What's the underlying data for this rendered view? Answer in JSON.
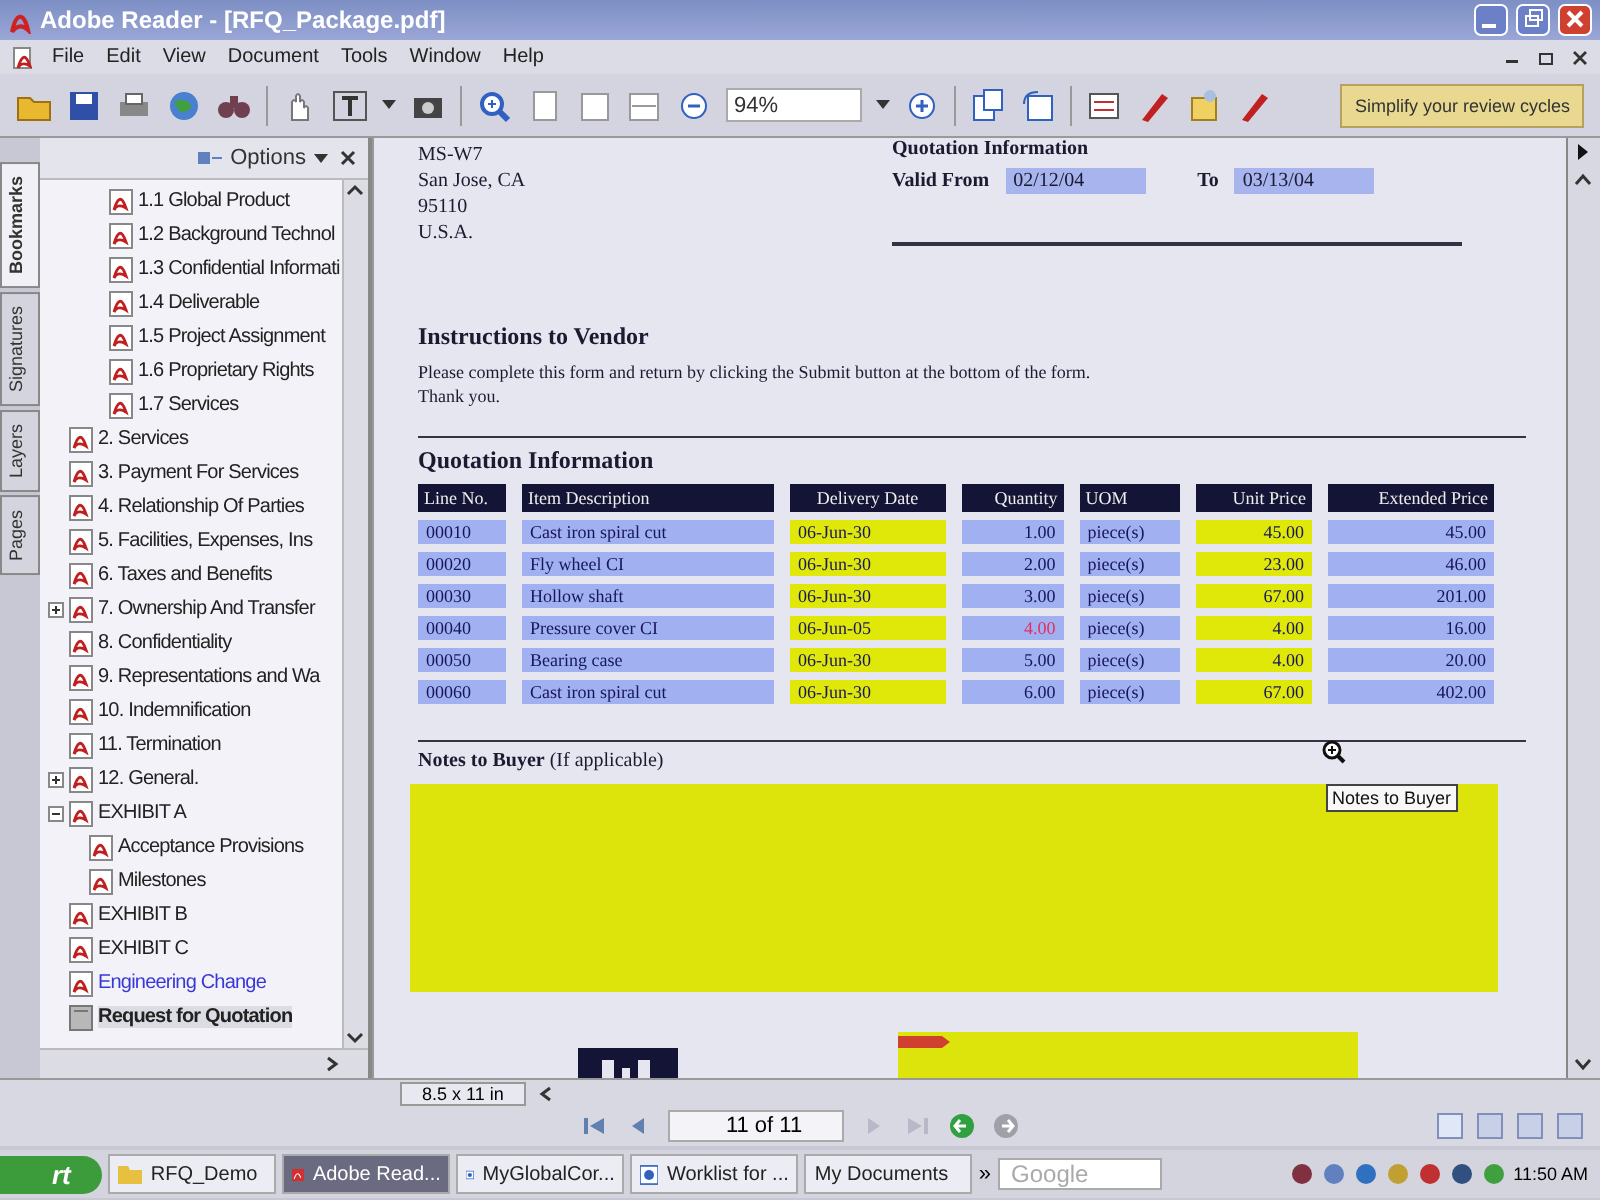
{
  "window": {
    "title": "Adobe Reader - [RFQ_Package.pdf]"
  },
  "menu": [
    "File",
    "Edit",
    "View",
    "Document",
    "Tools",
    "Window",
    "Help"
  ],
  "toolbar": {
    "zoom": "94%",
    "promo": "Simplify your review cycles"
  },
  "sidebar": {
    "tabs": [
      {
        "label": "Bookmarks",
        "selected": true
      },
      {
        "label": "Signatures",
        "selected": false
      },
      {
        "label": "Layers",
        "selected": false
      },
      {
        "label": "Pages",
        "selected": false
      }
    ],
    "options": "Options",
    "bookmarks": [
      {
        "children": [
          {
            "label": "1.1 Global Product",
            "kind": "pdf",
            "selected": false
          },
          {
            "label": "1.2 Background Technol",
            "kind": "pdf",
            "selected": false
          },
          {
            "label": "1.3 Confidential Informati",
            "kind": "pdf",
            "selected": false
          },
          {
            "label": "1.4 Deliverable",
            "kind": "pdf",
            "selected": false
          },
          {
            "label": "1.5 Project Assignment",
            "kind": "pdf",
            "selected": false
          },
          {
            "label": "1.6 Proprietary Rights",
            "kind": "pdf",
            "selected": false
          },
          {
            "label": "1.7 Services",
            "kind": "pdf",
            "selected": false
          }
        ]
      },
      {
        "label": "2. Services",
        "kind": "pdf",
        "selected": false
      },
      {
        "label": "3. Payment For Services",
        "kind": "pdf",
        "selected": false
      },
      {
        "label": "4. Relationship Of Parties",
        "kind": "pdf",
        "selected": false
      },
      {
        "label": "5. Facilities, Expenses, Ins",
        "kind": "pdf",
        "selected": false
      },
      {
        "label": "6. Taxes and Benefits",
        "kind": "pdf",
        "selected": false
      },
      {
        "label": "7. Ownership And Transfer",
        "kind": "pdf",
        "selected": false,
        "expanded": false
      },
      {
        "label": "8. Confidentiality",
        "kind": "pdf",
        "selected": false
      },
      {
        "label": "9. Representations and Wa",
        "kind": "pdf",
        "selected": false
      },
      {
        "label": "10. Indemnification",
        "kind": "pdf",
        "selected": false
      },
      {
        "label": "11. Termination",
        "kind": "pdf",
        "selected": false
      },
      {
        "label": "12. General.",
        "kind": "pdf",
        "selected": false,
        "expanded": false
      },
      {
        "label": "EXHIBIT A",
        "kind": "pdf",
        "selected": false,
        "expanded": true,
        "children": [
          {
            "label": "Acceptance Provisions",
            "kind": "pdf",
            "selected": false
          },
          {
            "label": "Milestones",
            "kind": "pdf",
            "selected": false
          }
        ]
      },
      {
        "label": "EXHIBIT B",
        "kind": "pdf",
        "selected": false
      },
      {
        "label": "EXHIBIT C",
        "kind": "pdf",
        "selected": false
      },
      {
        "label": "Engineering Change",
        "kind": "link",
        "selected": false
      },
      {
        "label": "Request for Quotation",
        "kind": "doc",
        "selected": true
      }
    ]
  },
  "document": {
    "address": [
      "MS-W7",
      "San Jose, CA",
      "95110",
      "U.S.A."
    ],
    "quotation_header": "Quotation Information",
    "valid_from_label": "Valid From",
    "valid_from": "02/12/04",
    "to_label": "To",
    "valid_to": "03/13/04",
    "instructions_title": "Instructions to Vendor",
    "instructions": [
      "Please complete this form and return by clicking the Submit button at the bottom of the form.",
      "Thank you."
    ],
    "table_title": "Quotation Information",
    "columns": [
      "Line No.",
      "Item Description",
      "Delivery Date",
      "Quantity",
      "UOM",
      "Unit Price",
      "Extended Price"
    ],
    "rows": [
      {
        "cells": [
          "00010",
          "Cast iron spiral cut",
          "06-Jun-30",
          "1.00",
          "piece(s)",
          "45.00",
          "45.00"
        ],
        "invalid": false
      },
      {
        "cells": [
          "00020",
          "Fly wheel CI",
          "06-Jun-30",
          "2.00",
          "piece(s)",
          "23.00",
          "46.00"
        ],
        "invalid": false
      },
      {
        "cells": [
          "00030",
          "Hollow shaft",
          "06-Jun-30",
          "3.00",
          "piece(s)",
          "67.00",
          "201.00"
        ],
        "invalid": false
      },
      {
        "cells": [
          "00040",
          "Pressure cover CI",
          "06-Jun-05",
          "4.00",
          "piece(s)",
          "4.00",
          "16.00"
        ],
        "invalid": true
      },
      {
        "cells": [
          "00050",
          "Bearing case",
          "06-Jun-30",
          "5.00",
          "piece(s)",
          "4.00",
          "20.00"
        ],
        "invalid": false
      },
      {
        "cells": [
          "00060",
          "Cast iron spiral cut",
          "06-Jun-30",
          "6.00",
          "piece(s)",
          "67.00",
          "402.00"
        ],
        "invalid": false
      }
    ],
    "notes_label": "**Notes to Buyer** (If applicable)",
    "tooltip": "Notes to Buyer"
  },
  "status": {
    "page_size": "8.5 x 11 in",
    "page": "11 of 11"
  },
  "taskbar": {
    "start": "rt",
    "tasks": [
      {
        "label": "RFQ_Demo",
        "selected": false
      },
      {
        "label": "Adobe Read...",
        "selected": true
      },
      {
        "label": "MyGlobalCor...",
        "selected": false
      },
      {
        "label": "Worklist for ...",
        "selected": false
      },
      {
        "label": "My Documents",
        "selected": false
      }
    ],
    "more": "»",
    "search": "Google",
    "clock": "11:50 AM"
  }
}
